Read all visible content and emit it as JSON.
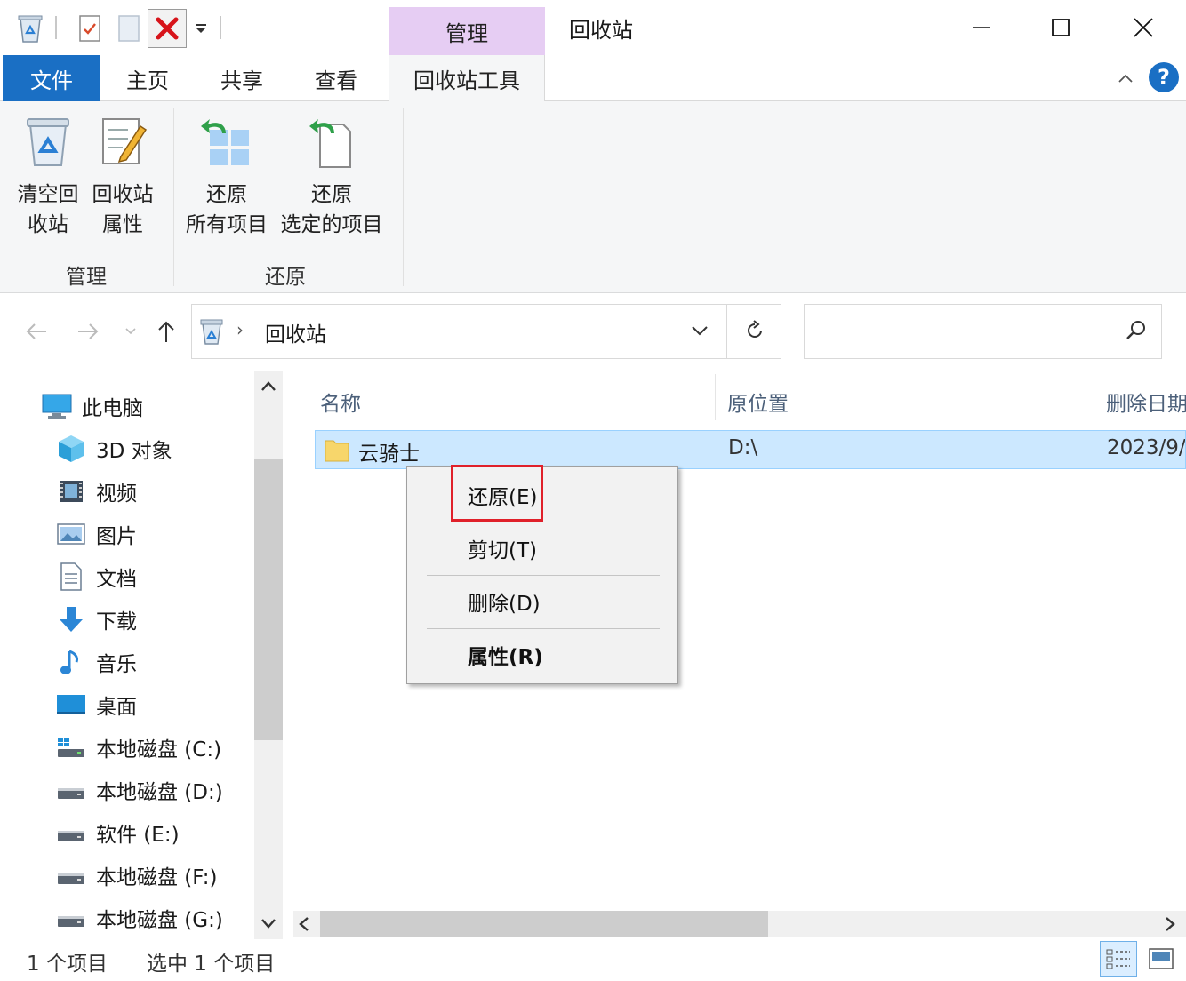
{
  "titlebar": {
    "context_tab": "管理",
    "window_title": "回收站"
  },
  "ribbon": {
    "tabs": [
      {
        "label": "文件"
      },
      {
        "label": "主页"
      },
      {
        "label": "共享"
      },
      {
        "label": "查看"
      },
      {
        "label": "回收站工具"
      }
    ],
    "buttons": {
      "empty": {
        "line1": "清空回",
        "line2": "收站"
      },
      "properties": {
        "line1": "回收站",
        "line2": "属性"
      },
      "restore_all": {
        "line1": "还原",
        "line2": "所有项目"
      },
      "restore_selected": {
        "line1": "还原",
        "line2": "选定的项目"
      }
    },
    "groups": {
      "manage": "管理",
      "restore": "还原"
    }
  },
  "address": {
    "path_current": "回收站",
    "search_placeholder": ""
  },
  "nav": {
    "items": [
      {
        "label": "此电脑",
        "icon": "computer-icon"
      },
      {
        "label": "3D 对象",
        "icon": "3d-objects-icon"
      },
      {
        "label": "视频",
        "icon": "video-icon"
      },
      {
        "label": "图片",
        "icon": "pictures-icon"
      },
      {
        "label": "文档",
        "icon": "documents-icon"
      },
      {
        "label": "下载",
        "icon": "download-icon"
      },
      {
        "label": "音乐",
        "icon": "music-icon"
      },
      {
        "label": "桌面",
        "icon": "desktop-icon"
      },
      {
        "label": "本地磁盘 (C:)",
        "icon": "system-drive-icon"
      },
      {
        "label": "本地磁盘 (D:)",
        "icon": "drive-icon"
      },
      {
        "label": "软件 (E:)",
        "icon": "drive-icon"
      },
      {
        "label": "本地磁盘 (F:)",
        "icon": "drive-icon"
      },
      {
        "label": "本地磁盘 (G:)",
        "icon": "drive-icon"
      }
    ]
  },
  "filelist": {
    "columns": [
      "名称",
      "原位置",
      "删除日期"
    ],
    "rows": [
      {
        "name": "云骑士",
        "location": "D:\\",
        "deleted": "2023/9/"
      }
    ]
  },
  "context_menu": {
    "items": [
      {
        "label": "还原(E)"
      },
      {
        "label": "剪切(T)"
      },
      {
        "label": "删除(D)"
      },
      {
        "label": "属性(R)"
      }
    ],
    "highlight_color": "#e0202a"
  },
  "status": {
    "count": "1 个项目",
    "selected": "选中 1 个项目"
  },
  "colors": {
    "file_tab": "#1a6fc4",
    "context_tab": "#e6cdf3",
    "selection": "#cce8ff",
    "help": "#1a6fc4"
  }
}
